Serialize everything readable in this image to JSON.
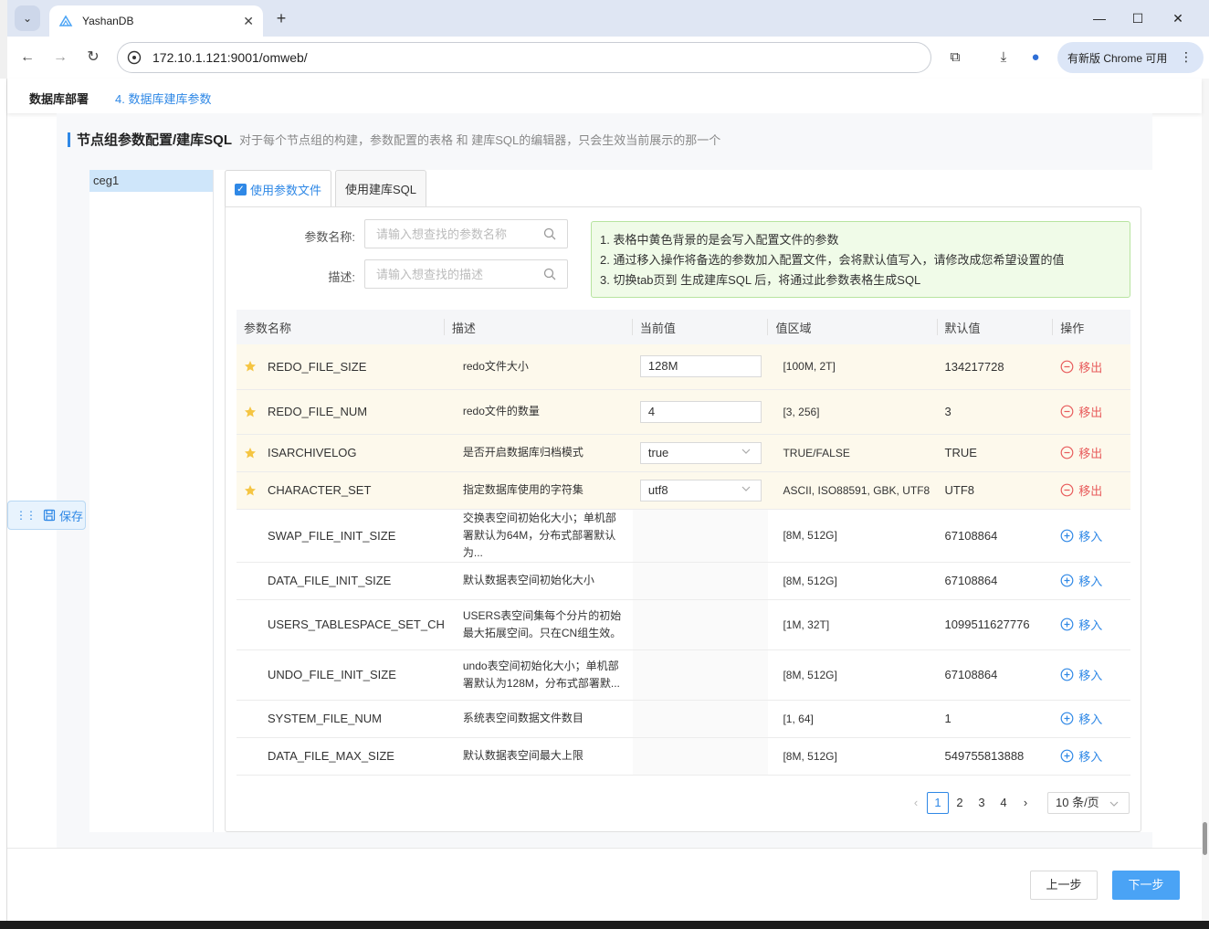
{
  "browser": {
    "tab_title": "YashanDB",
    "url": "172.10.1.121:9001/omweb/",
    "update_label": "有新版 Chrome 可用"
  },
  "breadcrumb": {
    "step_parent": "数据库部署",
    "step_current": "4. 数据库建库参数"
  },
  "section": {
    "title": "节点组参数配置/建库SQL",
    "desc": "对于每个节点组的构建，参数配置的表格 和 建库SQL的编辑器，只会生效当前展示的那一个"
  },
  "node_groups": [
    "ceg1"
  ],
  "tabs": {
    "param_file": "使用参数文件",
    "create_sql": "使用建库SQL"
  },
  "search": {
    "name_label": "参数名称:",
    "name_placeholder": "请输入想查找的参数名称",
    "desc_label": "描述:",
    "desc_placeholder": "请输入想查找的描述"
  },
  "tips": [
    "1. 表格中黄色背景的是会写入配置文件的参数",
    "2. 通过移入操作将备选的参数加入配置文件，会将默认值写入，请修改成您希望设置的值",
    "3. 切换tab页到 生成建库SQL 后，将通过此参数表格生成SQL"
  ],
  "table": {
    "headers": [
      "参数名称",
      "描述",
      "当前值",
      "值区域",
      "默认值",
      "操作"
    ],
    "rows": [
      {
        "name": "REDO_FILE_SIZE",
        "desc": "redo文件大小",
        "current": "128M",
        "current_type": "input",
        "range": "[100M, 2T]",
        "default": "134217728",
        "action": "移出",
        "in_file": true
      },
      {
        "name": "REDO_FILE_NUM",
        "desc": "redo文件的数量",
        "current": "4",
        "current_type": "input",
        "range": "[3, 256]",
        "default": "3",
        "action": "移出",
        "in_file": true
      },
      {
        "name": "ISARCHIVELOG",
        "desc": "是否开启数据库归档模式",
        "current": "true",
        "current_type": "select",
        "range": "TRUE/FALSE",
        "default": "TRUE",
        "action": "移出",
        "in_file": true
      },
      {
        "name": "CHARACTER_SET",
        "desc": "指定数据库使用的字符集",
        "current": "utf8",
        "current_type": "select",
        "range": "ASCII, ISO88591, GBK, UTF8",
        "default": "UTF8",
        "action": "移出",
        "in_file": true
      },
      {
        "name": "SWAP_FILE_INIT_SIZE",
        "desc": "交换表空间初始化大小；单机部署默认为64M，分布式部署默认为...",
        "current": "",
        "current_type": "none",
        "range": "[8M, 512G]",
        "default": "67108864",
        "action": "移入",
        "in_file": false
      },
      {
        "name": "DATA_FILE_INIT_SIZE",
        "desc": "默认数据表空间初始化大小",
        "current": "",
        "current_type": "none",
        "range": "[8M, 512G]",
        "default": "67108864",
        "action": "移入",
        "in_file": false
      },
      {
        "name": "USERS_TABLESPACE_SET_CH",
        "desc": "USERS表空间集每个分片的初始最大拓展空间。只在CN组生效。",
        "current": "",
        "current_type": "none",
        "range": "[1M, 32T]",
        "default": "1099511627776",
        "action": "移入",
        "in_file": false
      },
      {
        "name": "UNDO_FILE_INIT_SIZE",
        "desc": "undo表空间初始化大小；单机部署默认为128M，分布式部署默...",
        "current": "",
        "current_type": "none",
        "range": "[8M, 512G]",
        "default": "67108864",
        "action": "移入",
        "in_file": false
      },
      {
        "name": "SYSTEM_FILE_NUM",
        "desc": "系统表空间数据文件数目",
        "current": "",
        "current_type": "none",
        "range": "[1, 64]",
        "default": "1",
        "action": "移入",
        "in_file": false
      },
      {
        "name": "DATA_FILE_MAX_SIZE",
        "desc": "默认数据表空间最大上限",
        "current": "",
        "current_type": "none",
        "range": "[8M, 512G]",
        "default": "549755813888",
        "action": "移入",
        "in_file": false
      }
    ]
  },
  "pagination": {
    "pages": [
      "1",
      "2",
      "3",
      "4"
    ],
    "current": "1",
    "page_size": "10 条/页"
  },
  "float_save": "保存",
  "footer": {
    "prev": "上一步",
    "next": "下一步"
  },
  "colors": {
    "accent": "#2f88e6",
    "in_file_row": "#fdf9ec",
    "remove": "#e85c5c",
    "tips_bg": "#f0fbe8"
  }
}
